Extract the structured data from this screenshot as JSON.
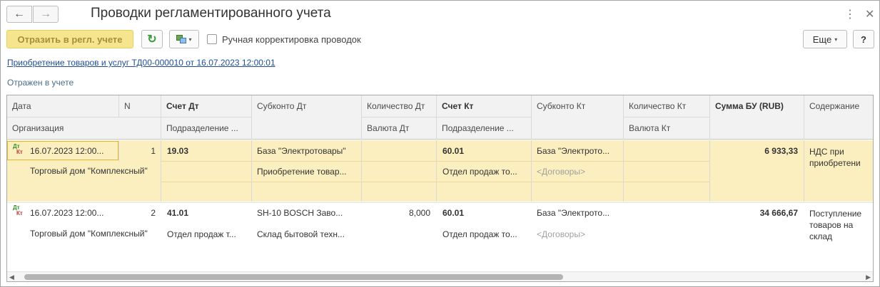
{
  "window": {
    "title": "Проводки регламентированного учета",
    "back_icon": "←",
    "forward_icon": "→",
    "more_icon": "⋮",
    "close_icon": "✕"
  },
  "toolbar": {
    "reflect_button": "Отразить в регл. учете",
    "refresh_icon": "↻",
    "structure_caret": "▾",
    "manual_checkbox_label": "Ручная корректировка проводок",
    "manual_checkbox_checked": false,
    "more_button": "Еще",
    "more_caret": "▾",
    "help_button": "?"
  },
  "document_link": "Приобретение товаров и услуг ТД00-000010 от 16.07.2023 12:00:01",
  "status": "Отражен в учете",
  "table": {
    "headers": {
      "date": "Дата",
      "n": "N",
      "account_dt": "Счет Дт",
      "subconto_dt": "Субконто Дт",
      "qty_dt": "Количество Дт",
      "account_kt": "Счет Кт",
      "subconto_kt": "Субконто Кт",
      "qty_kt": "Количество Кт",
      "sum": "Сумма БУ (RUB)",
      "content": "Содержание",
      "organization": "Организация",
      "division_dt": "Подразделение ...",
      "currency_dt": "Валюта Дт",
      "division_kt": "Подразделение ...",
      "currency_kt": "Валюта Кт"
    },
    "rows": [
      {
        "icon_dt": "Дт",
        "icon_kt": "Кт",
        "date": "16.07.2023 12:00...",
        "n": "1",
        "organization": "Торговый дом \"Комплексный\"",
        "account_dt": "19.03",
        "subconto_dt_1": "База \"Электротовары\"",
        "subconto_dt_2": "Приобретение товар...",
        "qty_dt": "",
        "account_kt": "60.01",
        "division_kt": "Отдел продаж то...",
        "subconto_kt_1": "База \"Электрото...",
        "subconto_kt_2": "<Договоры>",
        "sum": "6 933,33",
        "content": "НДС при приобретени"
      },
      {
        "icon_dt": "Дт",
        "icon_kt": "Кт",
        "date": "16.07.2023 12:00...",
        "n": "2",
        "organization": "Торговый дом \"Комплексный\"",
        "account_dt": "41.01",
        "division_dt": "Отдел продаж т...",
        "subconto_dt_1": "SH-10 BOSCH Заво...",
        "subconto_dt_2": "Склад бытовой техн...",
        "qty_dt": "8,000",
        "account_kt": "60.01",
        "division_kt": "Отдел продаж то...",
        "subconto_kt_1": "База \"Электрото...",
        "subconto_kt_2": "<Договоры>",
        "sum": "34 666,67",
        "content": "Поступление товаров на склад"
      }
    ]
  },
  "scrollbar": {
    "left_arrow": "◀",
    "right_arrow": "▶"
  },
  "colors": {
    "selected_row": "#fbefbf",
    "primary_button": "#f6e58f",
    "link": "#1f4e96"
  }
}
